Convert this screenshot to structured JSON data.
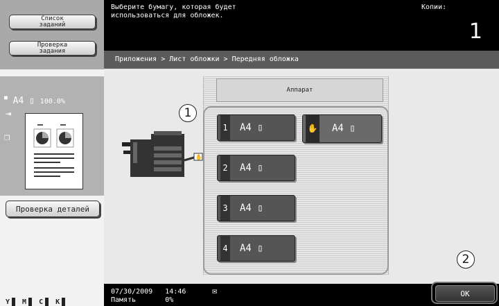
{
  "sidebar": {
    "job_list_label": "Список\nзаданий",
    "job_check_label": "Проверка\nзадания",
    "paper_size": "A4",
    "zoom": "100.0%",
    "details_button": "Проверка деталей",
    "toner": [
      {
        "label": "Y",
        "level": 0.8
      },
      {
        "label": "M",
        "level": 0.8
      },
      {
        "label": "C",
        "level": 0.8
      },
      {
        "label": "K",
        "level": 0.8
      }
    ]
  },
  "header": {
    "message": "Выберите бумагу, которая будет\nиспользоваться для обложек.",
    "copies_label": "Копии:",
    "copies_value": "1"
  },
  "breadcrumb": "Приложения > Лист обложки > Передняя обложка",
  "main": {
    "apparat_label": "Аппарат",
    "bypass_tray": {
      "label": "A4",
      "icon": "hand-icon"
    },
    "trays": [
      {
        "num": "1",
        "label": "A4"
      },
      {
        "num": "2",
        "label": "A4"
      },
      {
        "num": "3",
        "label": "A4"
      },
      {
        "num": "4",
        "label": "A4"
      }
    ],
    "callout_1": "1",
    "callout_2": "2"
  },
  "footer": {
    "date": "07/30/2009",
    "time": "14:46",
    "memory_label": "Память",
    "memory_value": "0%",
    "ok_label": "OK"
  }
}
